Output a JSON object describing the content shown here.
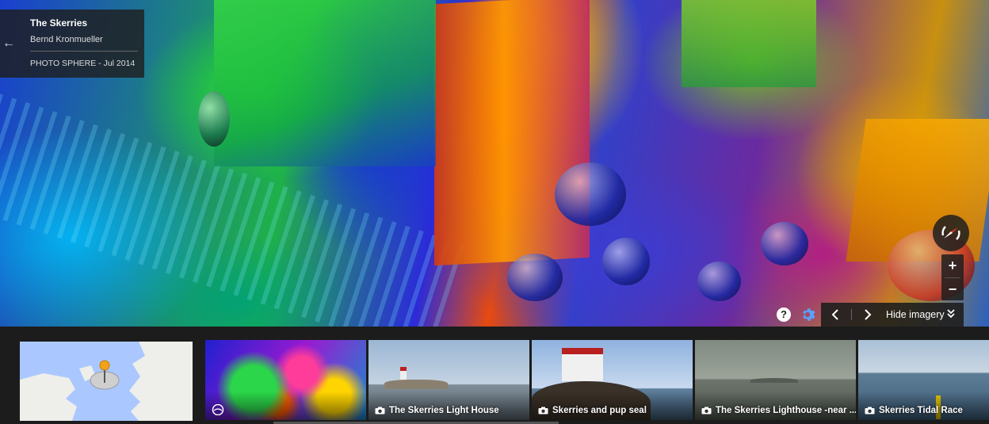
{
  "panorama": {
    "title": "The Skerries",
    "author": "Bernd Kronmueller",
    "meta": "PHOTO SPHERE - Jul 2014"
  },
  "controls": {
    "back_icon": "←",
    "help_icon": "?",
    "zoom_in": "+",
    "zoom_out": "−",
    "prev_icon": "‹",
    "next_icon": "›",
    "hide_imagery": "Hide imagery"
  },
  "strip": {
    "items": [
      {
        "caption": "",
        "type": "photosphere",
        "active": true
      },
      {
        "caption": "The Skerries Light House",
        "type": "photo"
      },
      {
        "caption": "Skerries and pup seal",
        "type": "photo"
      },
      {
        "caption": "The Skerries Lighthouse -near ...",
        "type": "photo"
      },
      {
        "caption": "Skerries Tidal Race",
        "type": "photo"
      }
    ]
  },
  "colors": {
    "panel_bg": "#1e1e1e",
    "map_water": "#aac8ff",
    "map_land": "#eeeeea",
    "pin": "#f2a31b"
  }
}
